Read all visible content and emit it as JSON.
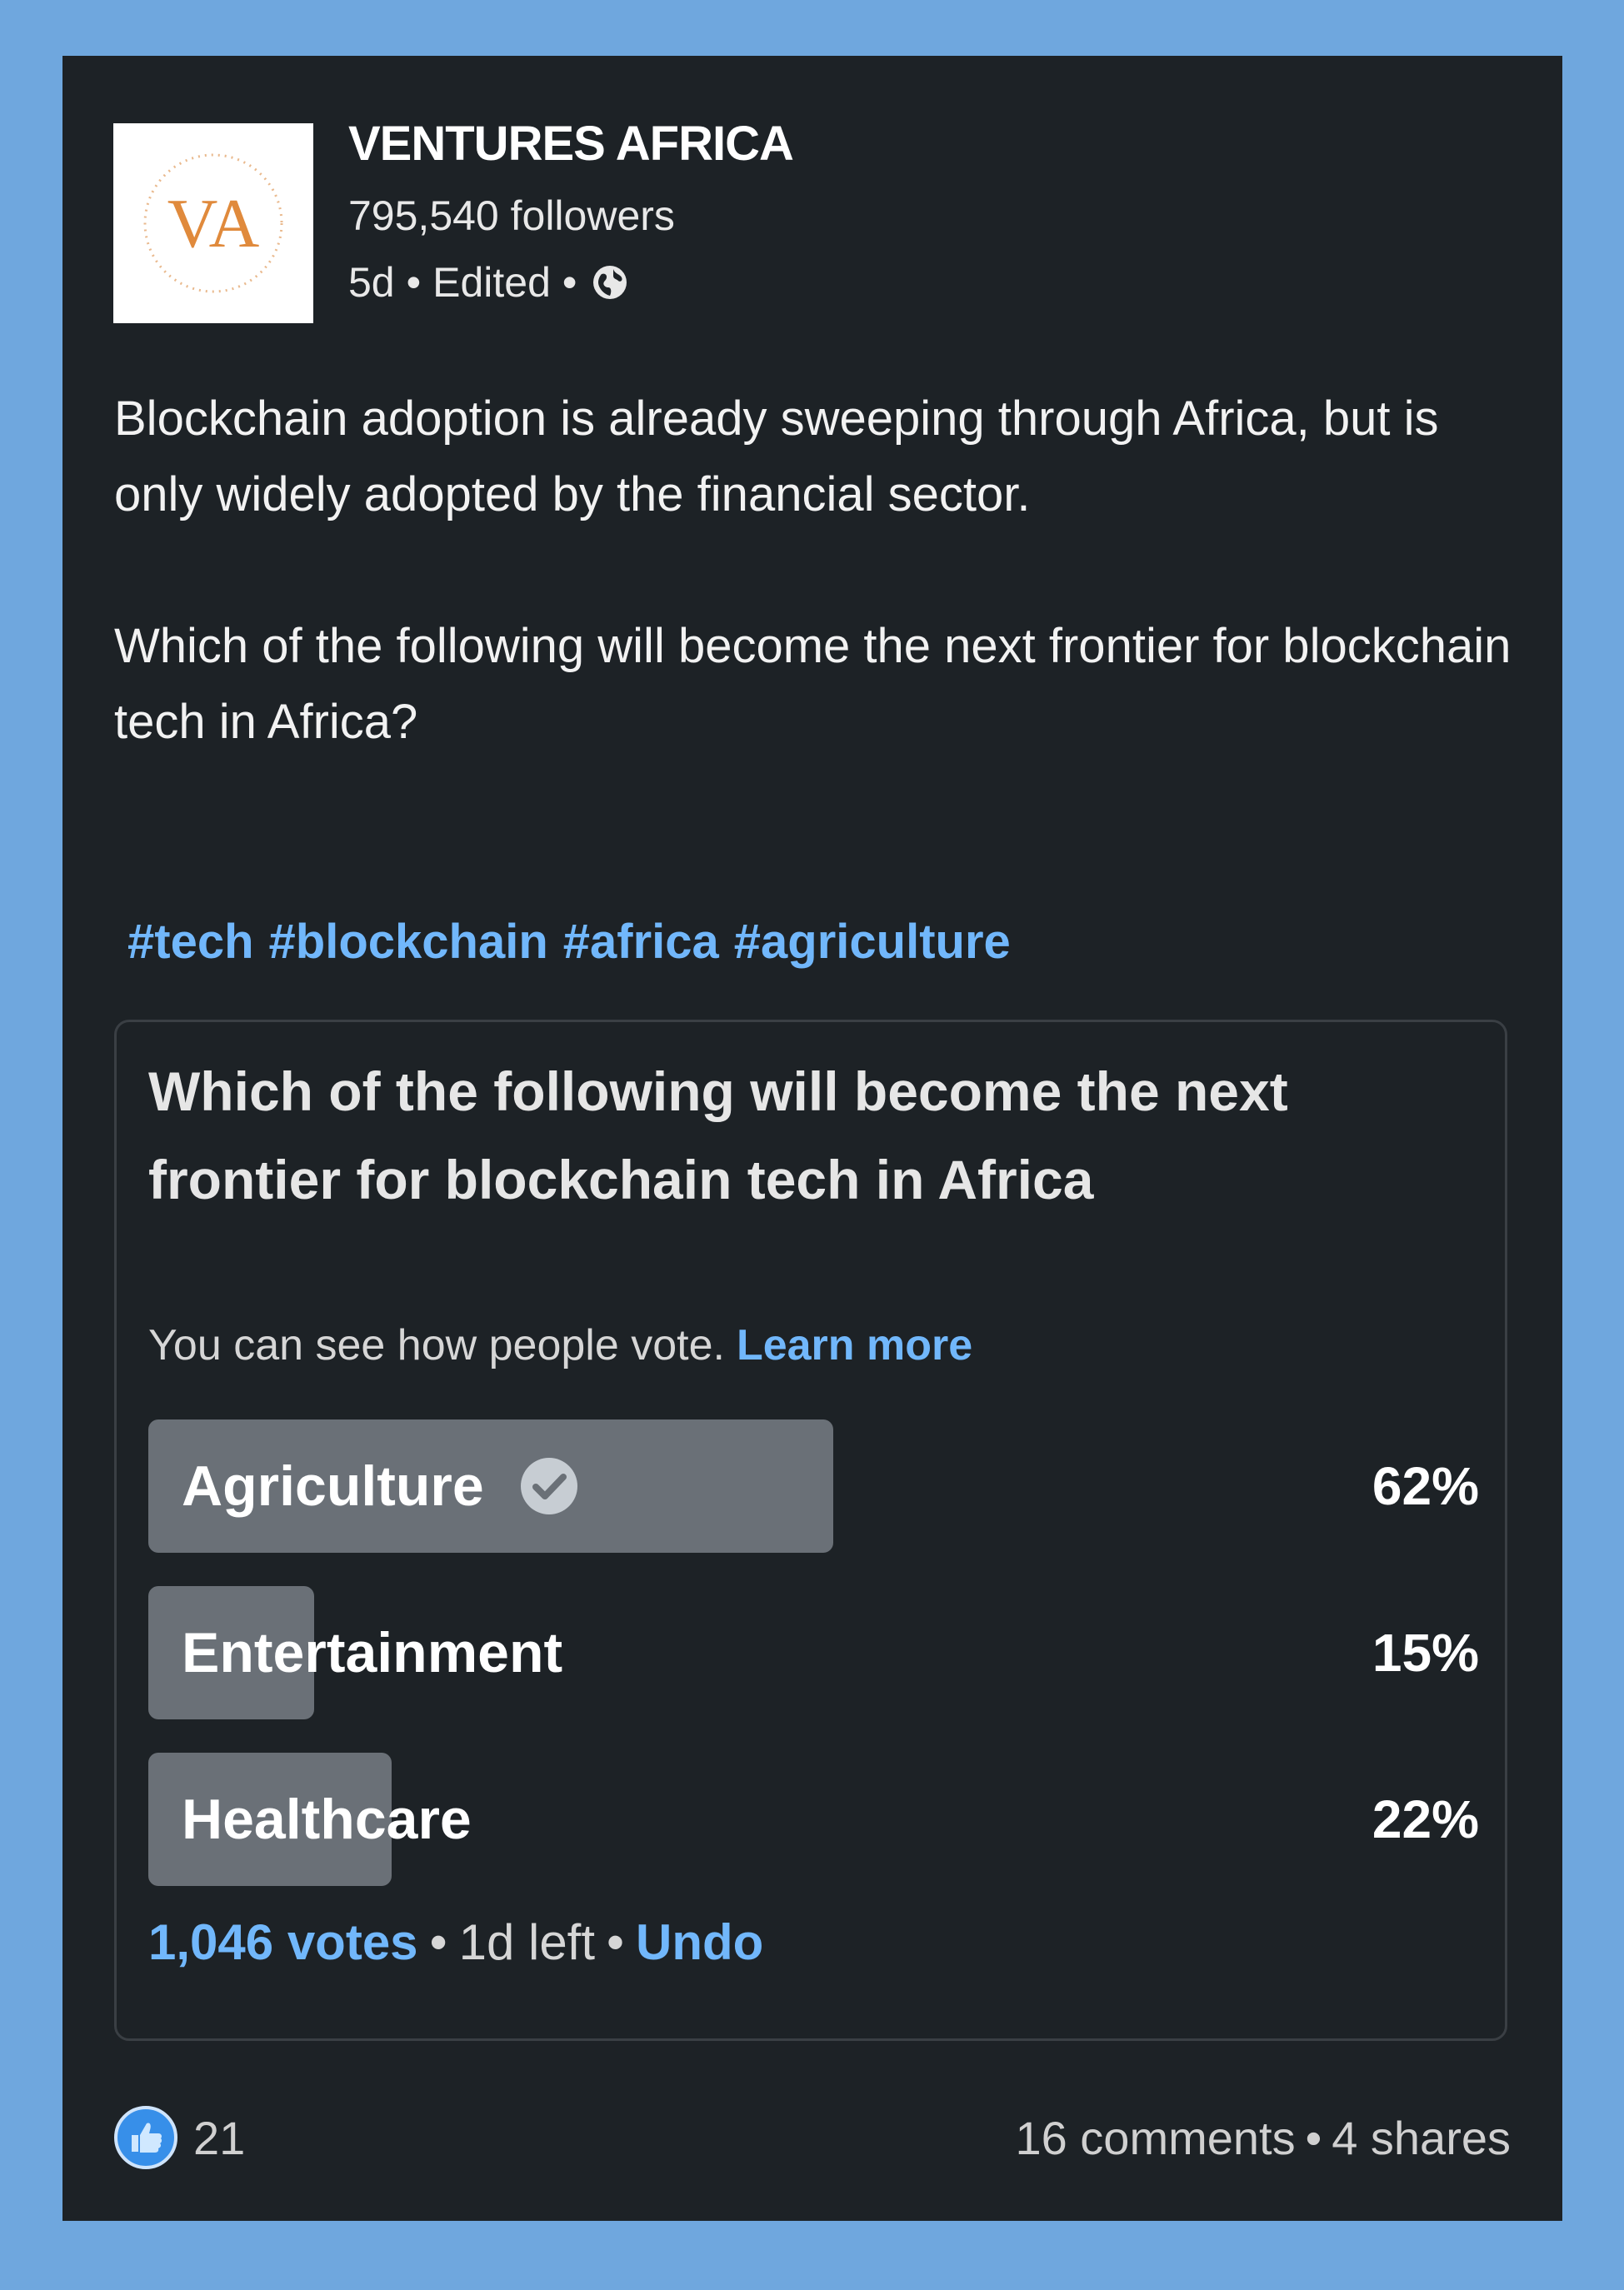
{
  "colors": {
    "page_background": "#6fa7de",
    "card_background": "#1d2226",
    "link_blue": "#71b7fb",
    "poll_bar": "#6a7077",
    "logo_orange": "#e08a3c"
  },
  "post": {
    "author": {
      "logo_text": "VA",
      "name": "VENTURES AFRICA",
      "followers": "795,540 followers",
      "time": "5d",
      "edited": "Edited",
      "visibility_icon": "globe-icon"
    },
    "text_paragraphs": [
      "Blockchain adoption is already sweeping through Africa, but is only widely adopted by the financial sector.",
      "Which of the following will become the next frontier for blockchain tech in Africa?"
    ],
    "hashtags": [
      "#tech",
      "#blockchain",
      "#africa",
      "#agriculture"
    ]
  },
  "poll": {
    "question": "Which of the following will become the next frontier for blockchain tech in Africa",
    "visibility_note": "You can see how people vote.",
    "learn_more": "Learn more",
    "options": [
      {
        "label": "Agriculture",
        "percent": "62%",
        "fraction": 0.62,
        "selected": true
      },
      {
        "label": "Entertainment",
        "percent": "15%",
        "fraction": 0.15,
        "selected": false
      },
      {
        "label": "Healthcare",
        "percent": "22%",
        "fraction": 0.22,
        "selected": false
      }
    ],
    "votes": "1,046 votes",
    "time_left": "1d left",
    "undo": "Undo"
  },
  "social": {
    "reaction_icon": "like-icon",
    "reaction_count": "21",
    "comments": "16 comments",
    "shares": "4 shares"
  }
}
